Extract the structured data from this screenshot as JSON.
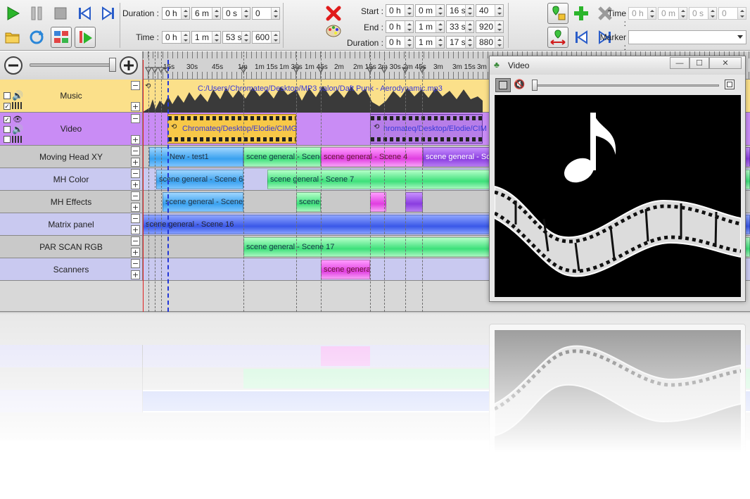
{
  "toolbar": {
    "duration_label": "Duration :",
    "duration": {
      "h": "0 h",
      "m": "6 m",
      "s": "0 s",
      "f": "0"
    },
    "time_label": "Time :",
    "time": {
      "h": "0 h",
      "m": "1 m",
      "s": "53 s",
      "f": "600"
    },
    "start_label": "Start :",
    "start": {
      "h": "0 h",
      "m": "0 m",
      "s": "16 s",
      "f": "40"
    },
    "end_label": "End :",
    "end": {
      "h": "0 h",
      "m": "1 m",
      "s": "33 s",
      "f": "920"
    },
    "dur2_label": "Duration :",
    "dur2": {
      "h": "0 h",
      "m": "1 m",
      "s": "17 s",
      "f": "880"
    },
    "mtime_label": "Time :",
    "mtime": {
      "h": "0 h",
      "m": "0 m",
      "s": "0 s",
      "f": "0"
    },
    "marker_label": "Marker :",
    "marker_value": ""
  },
  "ruler": {
    "ticks": [
      "15s",
      "30s",
      "45s",
      "1m",
      "1m 15s",
      "1m 30s",
      "1m 45s",
      "2m",
      "2m 15s",
      "2m 30s",
      "2m 45s",
      "3m",
      "3m 15s",
      "3m 30s"
    ]
  },
  "tracks": [
    {
      "name": "Music"
    },
    {
      "name": "Video"
    },
    {
      "name": "Moving Head XY"
    },
    {
      "name": "MH Color"
    },
    {
      "name": "MH Effects"
    },
    {
      "name": "Matrix panel"
    },
    {
      "name": "PAR SCAN RGB"
    },
    {
      "name": "Scanners"
    }
  ],
  "blocks": {
    "music_file": "C:/Users/Chromateq/Desktop/MP3 salon/Daft Punk - Aerodynamic.mp3",
    "video1": "Chromateq/Desktop/Elodie/CIMG",
    "video2": "hromateq/Desktop/Elodie/CIM",
    "mh_xy": [
      "New - test1",
      "scene general - Scene",
      "scene general - Scene 4",
      "scene general - Sce"
    ],
    "mh_color": [
      "scene general - Scene 6",
      "scene general - Scene 7"
    ],
    "mh_effects": [
      "scene general - Scene",
      "scene"
    ],
    "matrix": "scene general - Scene 16",
    "par": "scene general - Scene 17",
    "scanners": "scene genera"
  },
  "video_window": {
    "title": "Video"
  },
  "colors": {
    "playhead": "#e02020",
    "track_music": "#fbe08a",
    "track_video": "#c98cf5",
    "track_lavender": "#c9c9f0",
    "track_grey": "#c9c9c9"
  }
}
